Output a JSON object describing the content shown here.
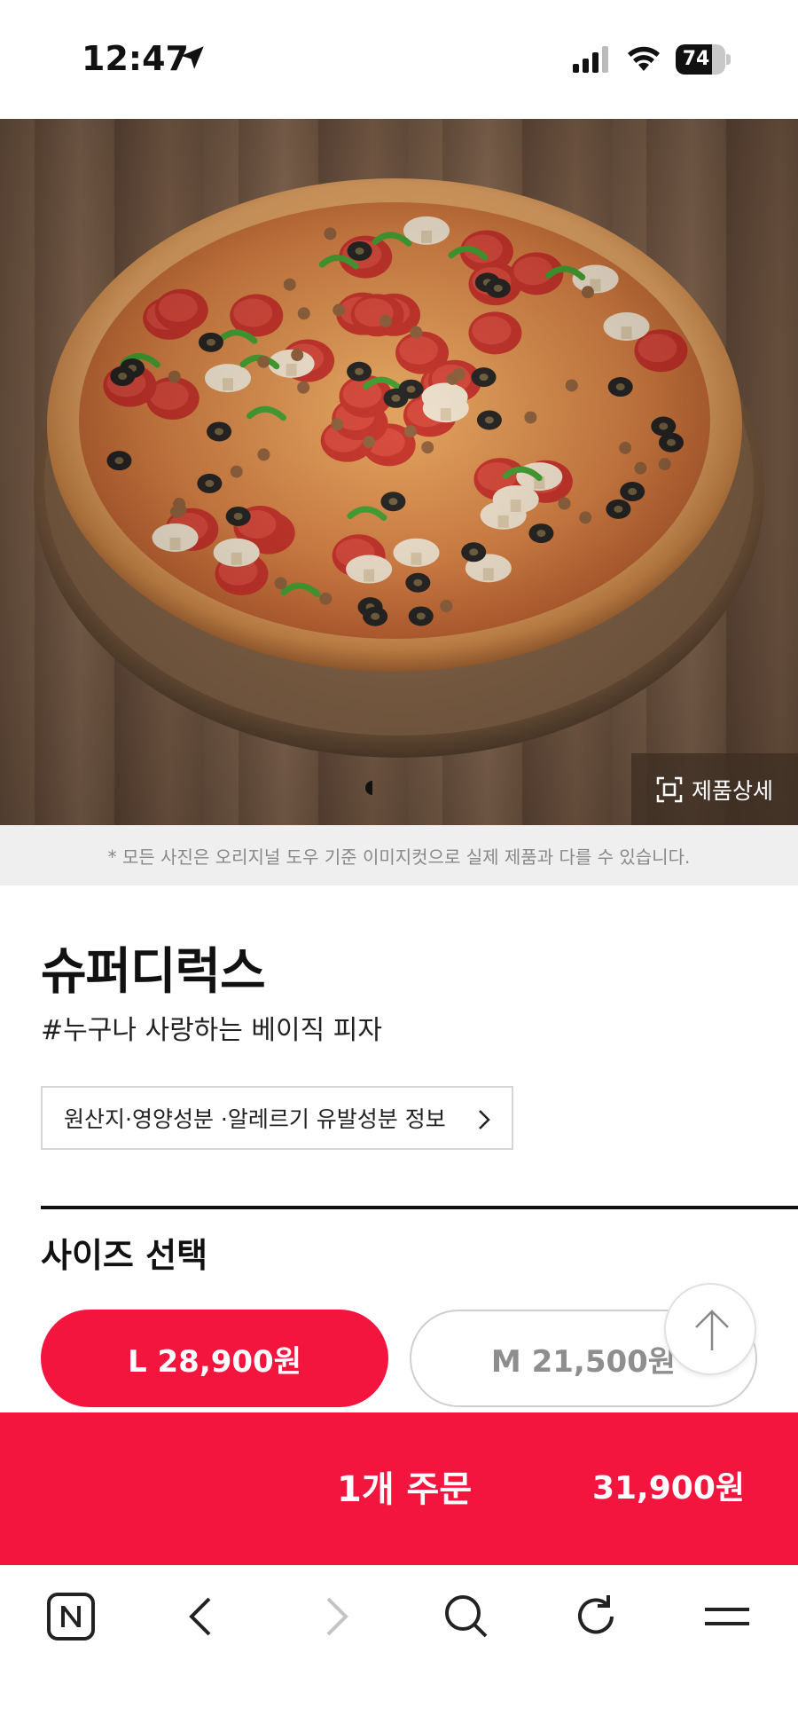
{
  "status_bar": {
    "time": "12:47",
    "battery": "74",
    "battery_level": 0.74,
    "icons": [
      "location-arrow-icon",
      "cellular-signal-icon",
      "wifi-icon",
      "battery-icon"
    ]
  },
  "hero": {
    "detail_button_label": "제품상세",
    "detail_icon": "expand-frame-icon",
    "disclaimer": "* 모든 사진은 오리지널 도우 기준 이미지컷으로 실제 제품과 다를 수 있습니다."
  },
  "product": {
    "name": "슈퍼디럭스",
    "tagline": "#누구나 사랑하는 베이직 피자",
    "info_button_label": "원산지·영양성분 ·알레르기 유발성분 정보"
  },
  "size_section": {
    "title": "사이즈 선택",
    "options": [
      {
        "label": "L 28,900원",
        "selected": true
      },
      {
        "label": "M 21,500원",
        "selected": false
      }
    ]
  },
  "order": {
    "label": "1개 주문",
    "price": "31,900원"
  },
  "browser_toolbar": {
    "icons": [
      "naver-n-icon",
      "back-icon",
      "forward-icon",
      "search-icon",
      "refresh-icon",
      "menu-icon"
    ]
  },
  "colors": {
    "brand_red": "#f4153f",
    "disclaimer_bg": "#efefef"
  }
}
